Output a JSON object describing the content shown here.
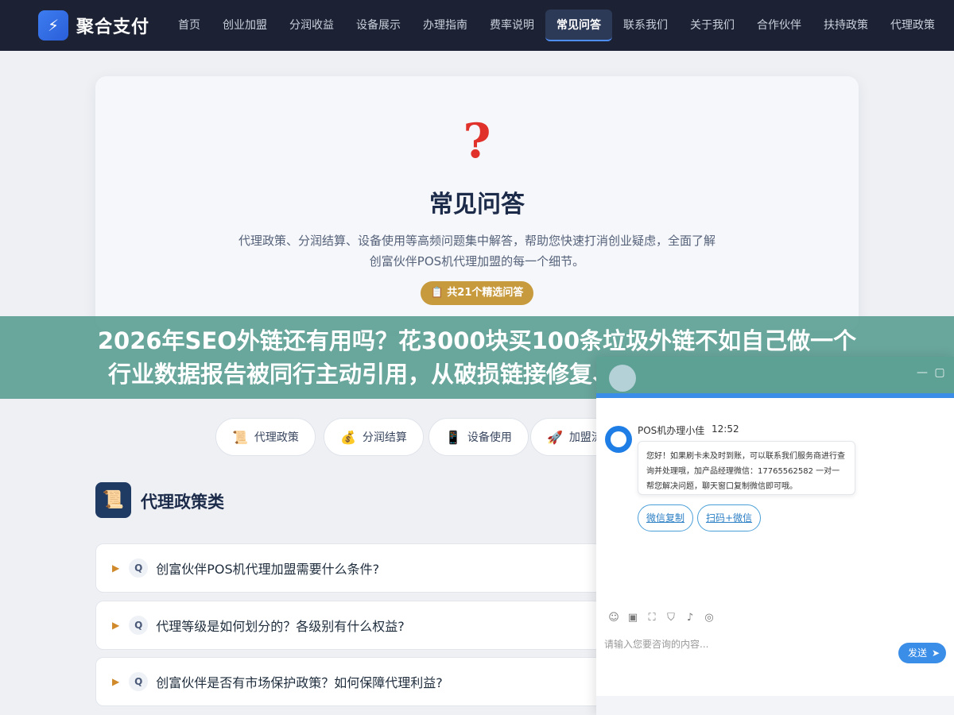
{
  "nav": {
    "logo_icon": "lightning-icon",
    "logo_text": "聚合支付",
    "items": [
      "首页",
      "创业加盟",
      "分润收益",
      "设备展示",
      "办理指南",
      "费率说明",
      "常见问答",
      "联系我们",
      "关于我们",
      "合作伙伴",
      "扶持政策",
      "代理政策"
    ],
    "active_index": 6
  },
  "hero": {
    "icon": "question-mark-icon",
    "icon_glyph": "?",
    "title": "常见问答",
    "desc": "代理政策、分润结算、设备使用等高频问题集中解答，帮助您快速打消创业疑虑，全面了解创富伙伴POS机代理加盟的每一个细节。",
    "badge": "📋 共21个精选问答"
  },
  "banner": {
    "line1": "2026年SEO外链还有用吗？花3000块买100条垃圾外链不如自己做一个",
    "line2": "行业数据报告被同行主动引用，从破损链接修复、未加链品牌提及转化、"
  },
  "categories": [
    {
      "icon": "📜",
      "label": "代理政策"
    },
    {
      "icon": "💰",
      "label": "分润结算"
    },
    {
      "icon": "📱",
      "label": "设备使用"
    },
    {
      "icon": "🚀",
      "label": "加盟流程"
    }
  ],
  "section": {
    "icon": "📜",
    "title": "代理政策类"
  },
  "faqs": [
    "创富伙伴POS机代理加盟需要什么条件?",
    "代理等级是如何划分的？各级别有什么权益?",
    "创富伙伴是否有市场保护政策？如何保障代理利益?"
  ],
  "faq_marker": "Q",
  "chat": {
    "agent_name": "POS机办理小佳",
    "time": "12:52",
    "message": "您好！如果刷卡未及时到账，可以联系我们服务商进行查询并处理哦，加产品经理微信：17765562582 一对一帮您解决问题，聊天窗口复制微信即可哦。",
    "buttons": [
      "微信复制",
      "扫码+微信"
    ],
    "input_placeholder": "请输入您要咨询的内容...",
    "send_label": "发送",
    "minimize": "—",
    "maximize": "▢"
  },
  "colors": {
    "nav_bg": "#1c2233",
    "accent": "#3b8ee8",
    "badge": "#c79a3e",
    "banner": "#5da094"
  }
}
